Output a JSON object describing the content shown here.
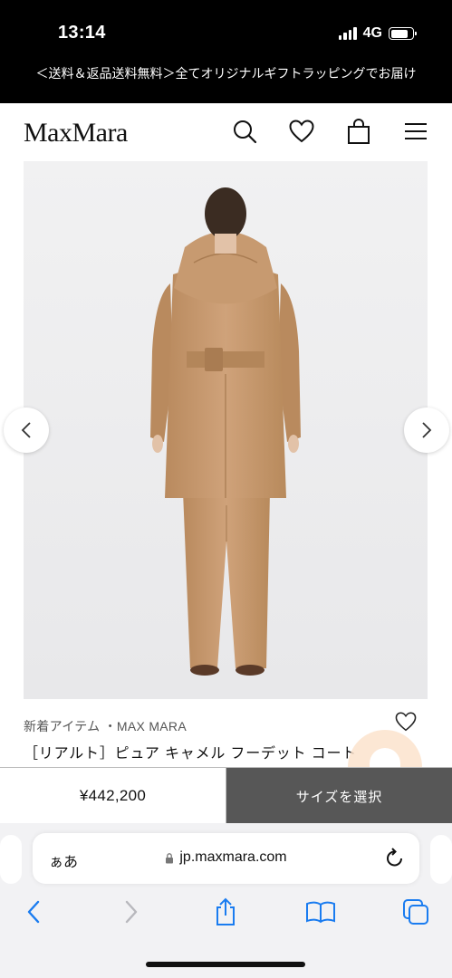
{
  "status_bar": {
    "time": "13:14",
    "network": "4G",
    "battery_level": 0.8
  },
  "promo_banner": {
    "text": "＜送料＆返品送料無料＞全てオリジナルギフトラッピングでお届け"
  },
  "header": {
    "logo": "MaxMara",
    "icons": [
      "search-icon",
      "heart-icon",
      "shopping-bag-icon",
      "menu-icon"
    ]
  },
  "product": {
    "category": "新着アイテム ・MAX MARA",
    "title": "［リアルト］ピュア キャメル フーデット コート",
    "price": "¥442,200",
    "size_button": "サイズを選択"
  },
  "browser": {
    "aa_label": "ぁあ",
    "url": "jp.maxmara.com",
    "accent_color": "#1a7cf0"
  }
}
